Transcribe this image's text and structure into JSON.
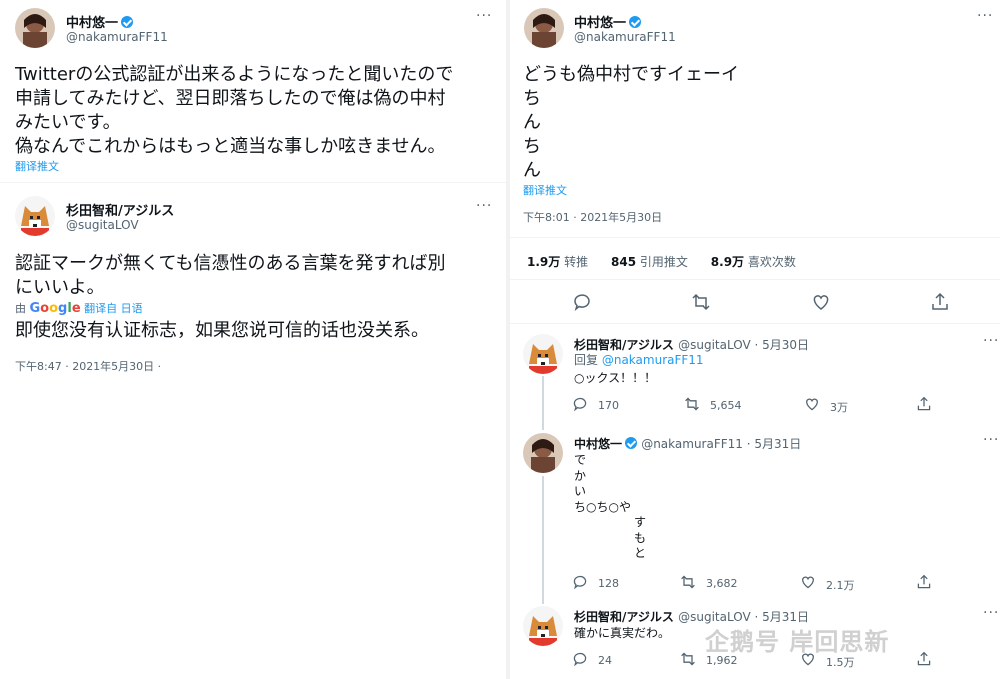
{
  "left": {
    "tweet1": {
      "name": "中村悠一",
      "handle": "@nakamuraFF11",
      "text": "Twitterの公式認証が出来るようになったと聞いたので\n申請してみたけど、翌日即落ちしたので俺は偽の中村\nみたいです。\n偽なんでこれからはもっと適当な事しか呟きません。",
      "translate": "翻译推文"
    },
    "tweet2": {
      "name": "杉田智和/アジルス",
      "handle": "@sugitaLOV",
      "text": "認証マークが無くても信憑性のある言葉を発すれば別\nにいいよ。",
      "by": "由",
      "google": "Google",
      "translated_from": "翻译自 日语",
      "translation": "即使您没有认证标志，如果您说可信的话也没关系。",
      "time": "下午8:47 · 2021年5月30日 ·"
    }
  },
  "right": {
    "main": {
      "name": "中村悠一",
      "handle": "@nakamuraFF11",
      "text": "どうも偽中村ですイェーイ\nち\nん\nち\nん",
      "translate": "翻译推文",
      "time": "下午8:01 · 2021年5月30日",
      "stats": {
        "retweets_num": "1.9万",
        "retweets_label": "转推",
        "quotes_num": "845",
        "quotes_label": "引用推文",
        "likes_num": "8.9万",
        "likes_label": "喜欢次数"
      }
    },
    "replies": [
      {
        "name": "杉田智和/アジルス",
        "meta": "@sugitaLOV · 5月30日",
        "reply_prefix": "回复",
        "reply_to": "@nakamuraFF11",
        "text": "○ックス！！！",
        "replies": "170",
        "retweets": "5,654",
        "likes": "3万"
      },
      {
        "name": "中村悠一",
        "meta": "@nakamuraFF11 · 5月31日",
        "text": "で\nか\nい\nち○ち○や\n　　　　　す\n　　　　　も\n　　　　　と",
        "replies": "128",
        "retweets": "3,682",
        "likes": "2.1万"
      },
      {
        "name": "杉田智和/アジルス",
        "meta": "@sugitaLOV · 5月31日",
        "text": "確かに真実だわ。",
        "replies": "24",
        "retweets": "1,962",
        "likes": "1.5万"
      }
    ]
  },
  "watermark": "企鹅号 岸回思新",
  "colors": {
    "accent": "#1d9bf0",
    "text": "#0f1419",
    "muted": "#536471"
  },
  "icons": [
    "reply-icon",
    "retweet-icon",
    "like-icon",
    "share-icon",
    "more-icon",
    "verified-icon"
  ]
}
